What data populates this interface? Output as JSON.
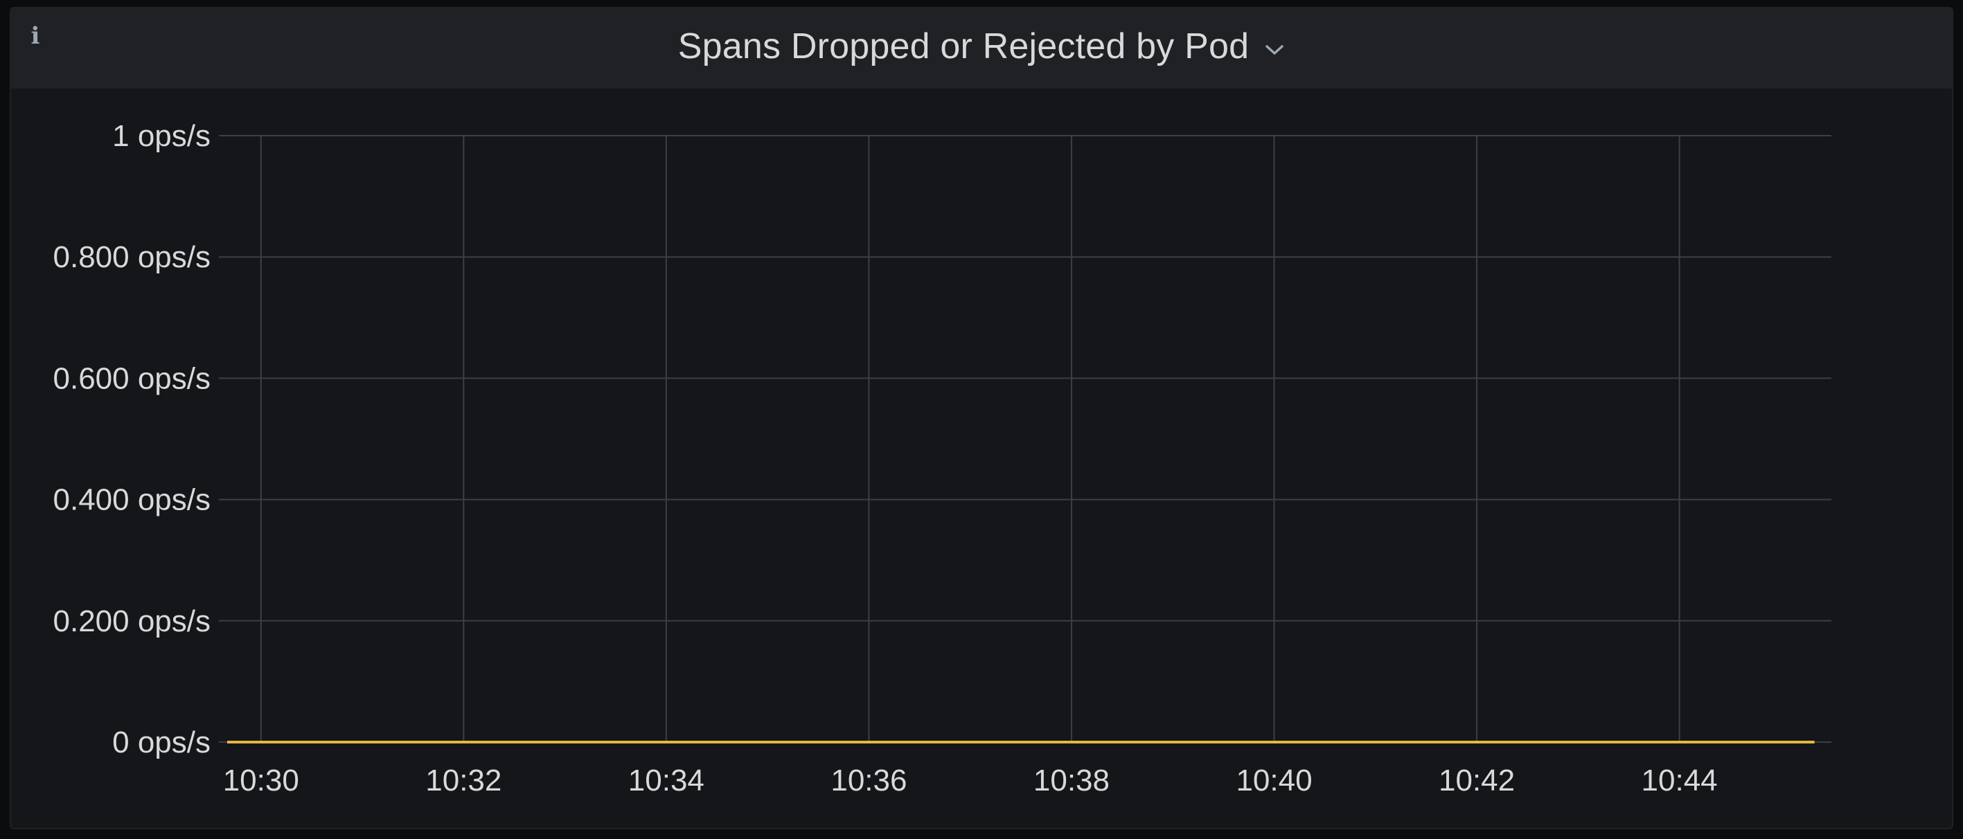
{
  "panel": {
    "title": "Spans Dropped or Rejected by Pod",
    "info_icon": "info-icon",
    "menu_icon": "chevron-down-icon"
  },
  "colors": {
    "panel_bg": "#141619",
    "header_bg": "#1f2125",
    "grid": "#3c3f45",
    "text": "#d8d9da",
    "series": "#e5b73b"
  },
  "chart_data": {
    "type": "line",
    "title": "Spans Dropped or Rejected by Pod",
    "xlabel": "",
    "ylabel": "",
    "x_tick_labels": [
      "10:30",
      "10:32",
      "10:34",
      "10:36",
      "10:38",
      "10:40",
      "10:42",
      "10:44"
    ],
    "y_tick_labels": [
      "0 ops/s",
      "0.200 ops/s",
      "0.400 ops/s",
      "0.600 ops/s",
      "0.800 ops/s",
      "1 ops/s"
    ],
    "y_ticks": [
      0,
      0.2,
      0.4,
      0.6,
      0.8,
      1
    ],
    "ylim": [
      0,
      1
    ],
    "xlim": [
      "10:29:40",
      "10:45:30"
    ],
    "grid": true,
    "legend": "none",
    "series": [
      {
        "color": "#e5b73b",
        "x": [
          "10:29:40",
          "10:31",
          "10:33",
          "10:35",
          "10:37",
          "10:39",
          "10:41",
          "10:43",
          "10:45",
          "10:45:20"
        ],
        "values": [
          0,
          0,
          0,
          0,
          0,
          0,
          0,
          0,
          0,
          0
        ]
      }
    ]
  }
}
